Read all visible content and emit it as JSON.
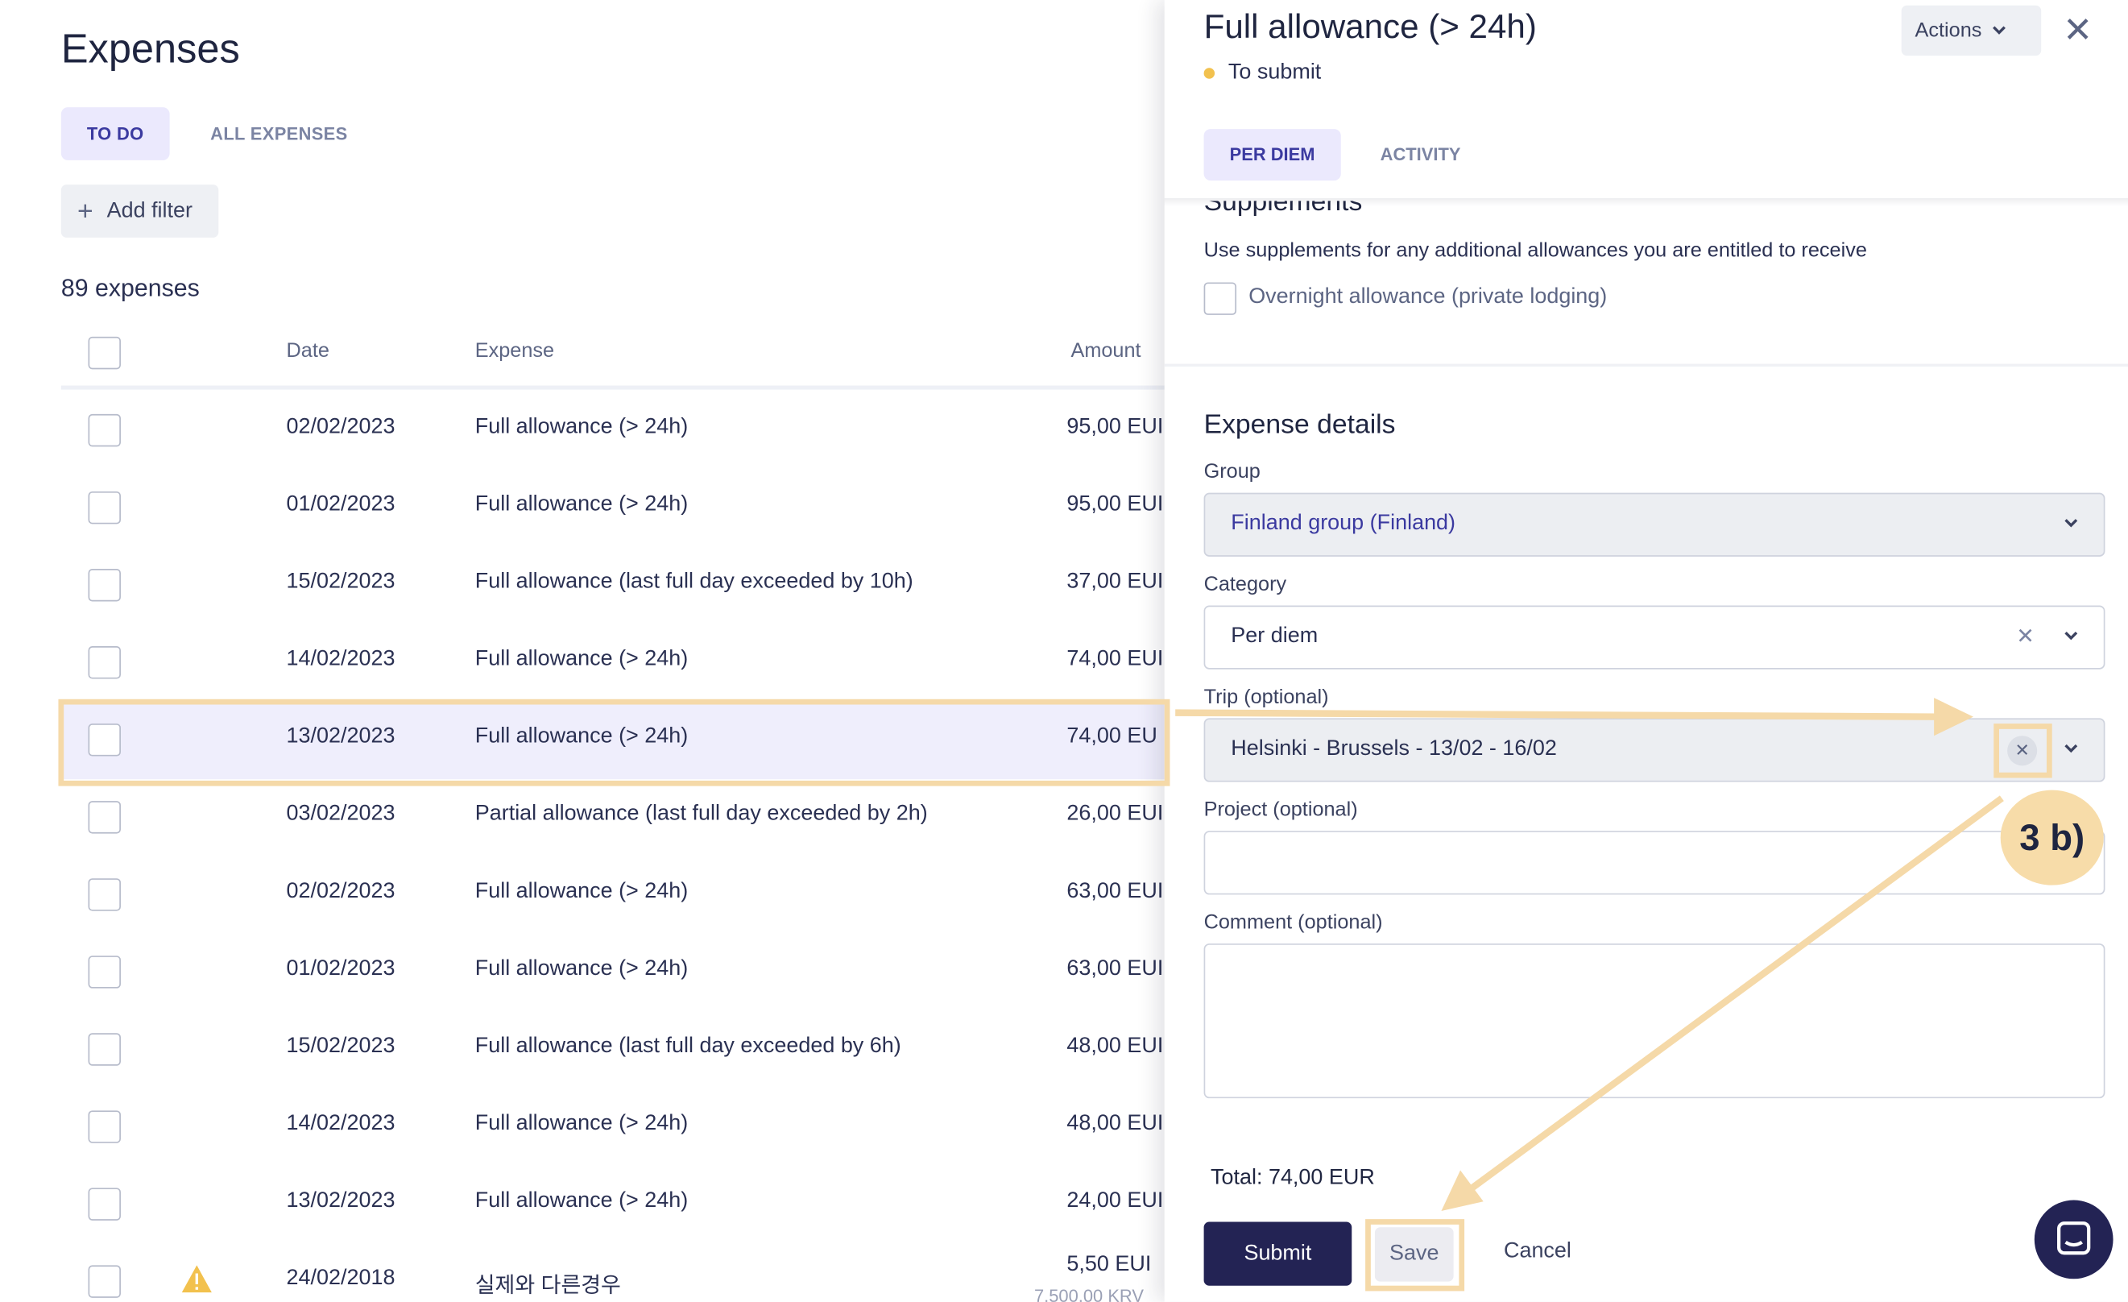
{
  "page": {
    "title": "Expenses",
    "tabs": [
      "TO DO",
      "ALL EXPENSES"
    ],
    "add_filter": "Add filter",
    "count": "89 expenses"
  },
  "table": {
    "headers": {
      "date": "Date",
      "expense": "Expense",
      "amount": "Amount"
    },
    "rows": [
      {
        "date": "02/02/2023",
        "expense": "Full allowance (> 24h)",
        "amount": "95,00 EUI"
      },
      {
        "date": "01/02/2023",
        "expense": "Full allowance (> 24h)",
        "amount": "95,00 EUI"
      },
      {
        "date": "15/02/2023",
        "expense": "Full allowance (last full day exceeded by 10h)",
        "amount": "37,00 EUI"
      },
      {
        "date": "14/02/2023",
        "expense": "Full allowance (> 24h)",
        "amount": "74,00 EUI"
      },
      {
        "date": "13/02/2023",
        "expense": "Full allowance (> 24h)",
        "amount": "74,00 EU"
      },
      {
        "date": "03/02/2023",
        "expense": "Partial allowance (last full day exceeded by 2h)",
        "amount": "26,00 EUI"
      },
      {
        "date": "02/02/2023",
        "expense": "Full allowance (> 24h)",
        "amount": "63,00 EUI"
      },
      {
        "date": "01/02/2023",
        "expense": "Full allowance (> 24h)",
        "amount": "63,00 EUI"
      },
      {
        "date": "15/02/2023",
        "expense": "Full allowance (last full day exceeded by 6h)",
        "amount": "48,00 EUI"
      },
      {
        "date": "14/02/2023",
        "expense": "Full allowance (> 24h)",
        "amount": "48,00 EUI"
      },
      {
        "date": "13/02/2023",
        "expense": "Full allowance (> 24h)",
        "amount": "24,00 EUI"
      },
      {
        "date": "24/02/2018",
        "expense": "실제와 다른경우",
        "amount": "5,50 EUI",
        "sub_amount": "7.500,00 KRV"
      }
    ]
  },
  "panel": {
    "title": "Full allowance (> 24h)",
    "status": "To submit",
    "actions": "Actions",
    "tabs": [
      "PER DIEM",
      "ACTIVITY"
    ],
    "supplements": {
      "title": "Supplements",
      "help": "Use supplements for any additional allowances you are entitled to receive",
      "checkbox": "Overnight allowance (private lodging)"
    },
    "details": {
      "title": "Expense details",
      "group_label": "Group",
      "group_value": "Finland group (Finland)",
      "category_label": "Category",
      "category_value": "Per diem",
      "trip_label": "Trip (optional)",
      "trip_value": "Helsinki - Brussels - 13/02 - 16/02",
      "project_label": "Project (optional)",
      "project_value": "",
      "comment_label": "Comment (optional)",
      "comment_value": ""
    },
    "total": "Total: 74,00 EUR",
    "buttons": {
      "submit": "Submit",
      "save": "Save",
      "cancel": "Cancel"
    }
  },
  "annotation": {
    "badge": "3 b)",
    "color": "#f5d9a8"
  },
  "colors": {
    "primary": "#232354",
    "accent_bg": "#ebe9fd",
    "status_dot": "#f2c14e",
    "highlight_row": "#efeefc"
  }
}
